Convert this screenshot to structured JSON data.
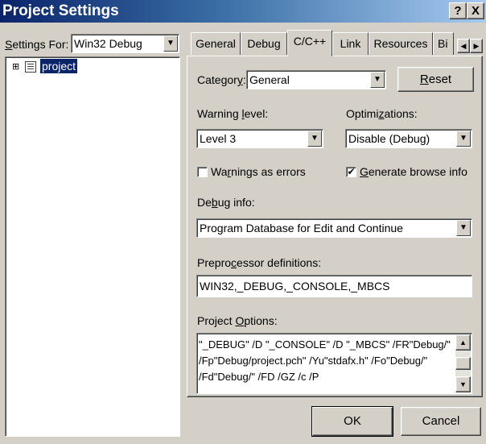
{
  "window": {
    "title": "Project Settings",
    "help_glyph": "?",
    "close_glyph": "X"
  },
  "left_pane": {
    "settings_for_label": "Settings For:",
    "settings_for_value": "Win32 Debug",
    "tree_expander": "⊞",
    "tree_item_label": "project"
  },
  "tabs": [
    {
      "label": "General"
    },
    {
      "label": "Debug"
    },
    {
      "label": "C/C++"
    },
    {
      "label": "Link"
    },
    {
      "label": "Resources"
    },
    {
      "label": "Bi"
    }
  ],
  "tab_scroll": {
    "left": "◀",
    "right": "▶"
  },
  "cpp": {
    "category_label": "Category:",
    "category_value": "General",
    "reset_label": "Reset",
    "warning_label": "Warning level:",
    "warning_value": "Level 3",
    "optimizations_label": "Optimizations:",
    "optimizations_value": "Disable (Debug)",
    "warnings_as_errors_label": "Warnings as errors",
    "warnings_as_errors_checked": false,
    "browse_info_label": "Generate browse info",
    "browse_info_checked": true,
    "check_mark": "✔",
    "debug_info_label": "Debug info:",
    "debug_info_value": "Program Database for Edit and Continue",
    "preprocessor_label": "Preprocessor definitions:",
    "preprocessor_value": "WIN32,_DEBUG,_CONSOLE,_MBCS",
    "project_options_label": "Project Options:",
    "project_options_lines": [
      "\"_DEBUG\" /D \"_CONSOLE\" /D \"_MBCS\" /FR\"Debug/\"",
      "/Fp\"Debug/project.pch\" /Yu\"stdafx.h\" /Fo\"Debug/\"",
      "/Fd\"Debug/\" /FD /GZ /c /P"
    ]
  },
  "footer": {
    "ok_label": "OK",
    "cancel_label": "Cancel"
  },
  "icons": {
    "dropdown": "▼",
    "scroll_up": "▲",
    "scroll_down": "▼"
  }
}
